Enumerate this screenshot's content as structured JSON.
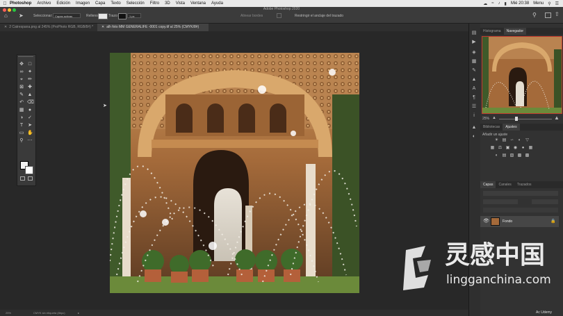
{
  "menubar": {
    "app": "Photoshop",
    "items": [
      "Archivo",
      "Edición",
      "Imagen",
      "Capa",
      "Texto",
      "Selección",
      "Filtro",
      "3D",
      "Vista",
      "Ventana",
      "Ayuda"
    ],
    "clock": "Mié 20:38",
    "menu_label": "Menu"
  },
  "window_title": "Adobe Photoshop 2020",
  "options": {
    "seleccionar_label": "Seleccionar:",
    "seleccionar_value": "Capas activas",
    "relleno_label": "Relleno:",
    "trazo_label": "Trazo:",
    "trazo_value": "1 px",
    "alinear_label": "Alinear bordes",
    "restringir_label": "Restringir el anclaje del trazado"
  },
  "tabs": [
    {
      "label": "2 Catrespana.png al 245% (ProPhoto RGB, RGB/8#) *",
      "active": false
    },
    {
      "label": "alh foto MM GENERALIFE -0001 copy.tif al 25% (CMYK/8#)",
      "active": true
    }
  ],
  "status": {
    "zoom": "25%",
    "info": "CMYK sin etiqueta (8bpc)"
  },
  "panels": {
    "top_tabs": [
      "Histograma",
      "Navegador"
    ],
    "nav_zoom": "25%",
    "adj_tabs": [
      "Bibliotecas",
      "Ajustes"
    ],
    "adj_title": "Añadir un ajuste",
    "layer_tabs": [
      "Capas",
      "Canales",
      "Trazados"
    ],
    "layer_name": "Fondo"
  },
  "watermark": {
    "cn": "灵感中国",
    "url": "lingganchina.com"
  },
  "badge": "Ac Udemy",
  "colors": {
    "accent": "#c43a2e",
    "menubar": "#e9e9e9",
    "panel": "#323232",
    "canvas": "#282828"
  }
}
